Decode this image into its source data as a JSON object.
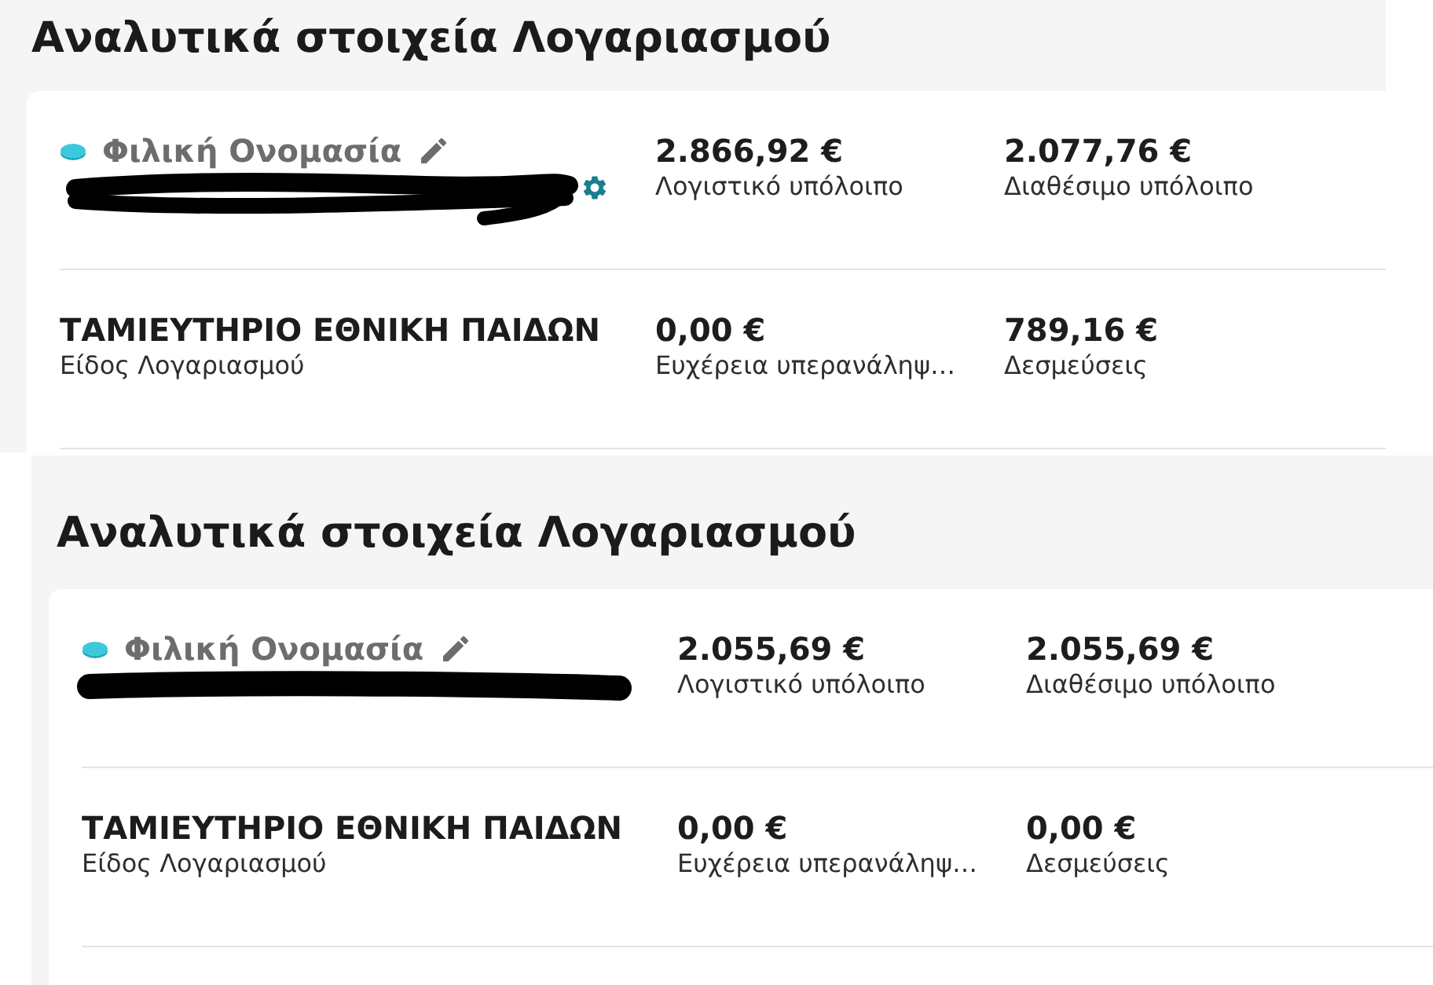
{
  "screens": [
    {
      "title": "Αναλυτικά στοιχεία Λογαριασμού",
      "rows": [
        {
          "kind": "account",
          "name": "Φιλική Ονομασία",
          "redaction": {
            "kind": "scribble"
          },
          "settings_icon": true,
          "figures": [
            {
              "amount": "2.866,92 €",
              "label": "Λογιστικό υπόλοιπο"
            },
            {
              "amount": "2.077,76 €",
              "label": "Διαθέσιμο υπόλοιπο"
            }
          ]
        },
        {
          "kind": "type",
          "name": "ΤΑΜΙΕΥΤΗΡΙΟ ΕΘΝΙΚΗ ΠΑΙΔΩΝ",
          "label": "Είδος Λογαριασμού",
          "figures": [
            {
              "amount": "0,00 €",
              "label": "Ευχέρεια υπερανάληψ…"
            },
            {
              "amount": "789,16 €",
              "label": "Δεσμεύσεις"
            }
          ]
        }
      ]
    },
    {
      "title": "Αναλυτικά στοιχεία Λογαριασμού",
      "rows": [
        {
          "kind": "account",
          "name": "Φιλική Ονομασία",
          "redaction": {
            "kind": "stroke"
          },
          "settings_icon": false,
          "figures": [
            {
              "amount": "2.055,69 €",
              "label": "Λογιστικό υπόλοιπο"
            },
            {
              "amount": "2.055,69 €",
              "label": "Διαθέσιμο υπόλοιπο"
            }
          ]
        },
        {
          "kind": "type",
          "name": "ΤΑΜΙΕΥΤΗΡΙΟ ΕΘΝΙΚΗ ΠΑΙΔΩΝ",
          "label": "Είδος Λογαριασμού",
          "figures": [
            {
              "amount": "0,00 €",
              "label": "Ευχέρεια υπερανάληψ…"
            },
            {
              "amount": "0,00 €",
              "label": "Δεσμεύσεις"
            }
          ]
        }
      ]
    }
  ]
}
